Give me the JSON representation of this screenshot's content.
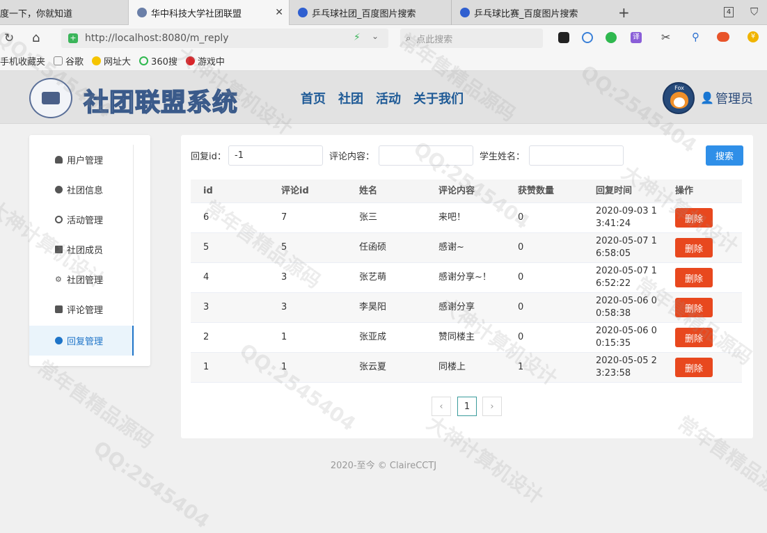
{
  "browser": {
    "tabs": [
      {
        "label": "度一下，你就知道"
      },
      {
        "label": "华中科技大学社团联盟"
      },
      {
        "label": "乒乓球社团_百度图片搜索"
      },
      {
        "label": "乒乓球比赛_百度图片搜索"
      }
    ],
    "tab_count": "4",
    "url": "http://localhost:8080/m_reply",
    "search_placeholder": "点此搜索",
    "bookmarks": [
      {
        "label": "手机收藏夹"
      },
      {
        "label": "谷歌"
      },
      {
        "label": "网址大"
      },
      {
        "label": "360搜"
      },
      {
        "label": "游戏中"
      }
    ]
  },
  "header": {
    "logo_title": "社团联盟系统",
    "nav": [
      "首页",
      "社团",
      "活动",
      "关于我们"
    ],
    "avatar_text": "Fox",
    "user_label": "管理员"
  },
  "sidebar": {
    "items": [
      {
        "label": "用户管理",
        "icon": "users-icon"
      },
      {
        "label": "社团信息",
        "icon": "info-icon"
      },
      {
        "label": "活动管理",
        "icon": "ball-icon"
      },
      {
        "label": "社团成员",
        "icon": "folder-icon"
      },
      {
        "label": "社团管理",
        "icon": "gear-icon"
      },
      {
        "label": "评论管理",
        "icon": "comment-icon"
      },
      {
        "label": "回复管理",
        "icon": "reply-icon"
      }
    ],
    "active": "回复管理"
  },
  "filters": {
    "reply_id_label": "回复id：",
    "reply_id_value": "-1",
    "comment_label": "评论内容：",
    "comment_value": "",
    "student_label": "学生姓名：",
    "student_value": "",
    "search_button": "搜索"
  },
  "table": {
    "headers": [
      "id",
      "评论id",
      "姓名",
      "评论内容",
      "获赞数量",
      "回复时间",
      "操作"
    ],
    "rows": [
      {
        "id": "6",
        "comment_id": "7",
        "name": "张三",
        "content": "来吧！",
        "likes": "0",
        "time_line1": "2020-09-03 1",
        "time_line2": "3:41:24",
        "action": "删除"
      },
      {
        "id": "5",
        "comment_id": "5",
        "name": "任函硕",
        "content": "感谢~",
        "likes": "0",
        "time_line1": "2020-05-07 1",
        "time_line2": "6:58:05",
        "action": "删除"
      },
      {
        "id": "4",
        "comment_id": "3",
        "name": "张艺萌",
        "content": "感谢分享~！",
        "likes": "0",
        "time_line1": "2020-05-07 1",
        "time_line2": "6:52:22",
        "action": "删除"
      },
      {
        "id": "3",
        "comment_id": "3",
        "name": "李昊阳",
        "content": "感谢分享",
        "likes": "0",
        "time_line1": "2020-05-06 0",
        "time_line2": "0:58:38",
        "action": "删除"
      },
      {
        "id": "2",
        "comment_id": "1",
        "name": "张亚成",
        "content": "赞同楼主",
        "likes": "0",
        "time_line1": "2020-05-06 0",
        "time_line2": "0:15:35",
        "action": "删除"
      },
      {
        "id": "1",
        "comment_id": "1",
        "name": "张云夏",
        "content": "同楼上",
        "likes": "1",
        "time_line1": "2020-05-05 2",
        "time_line2": "3:23:58",
        "action": "删除"
      }
    ]
  },
  "pagination": {
    "prev": "‹",
    "current": "1",
    "next": "›"
  },
  "footer": "2020-至今 © ClaireCCTJ",
  "watermarks": [
    "QQ:2545404",
    "大神计算机设计",
    "常年售精品源码"
  ]
}
